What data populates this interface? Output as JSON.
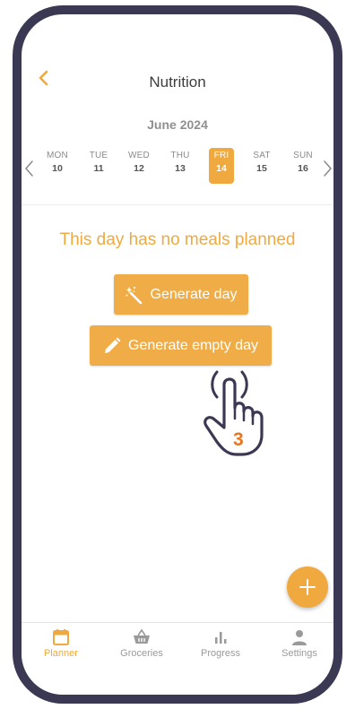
{
  "header": {
    "title": "Nutrition",
    "back_icon": "chevron-left-icon"
  },
  "calendar": {
    "month": "June 2024",
    "days": [
      {
        "name": "MON",
        "date": "10",
        "selected": false
      },
      {
        "name": "TUE",
        "date": "11",
        "selected": false
      },
      {
        "name": "WED",
        "date": "12",
        "selected": false
      },
      {
        "name": "THU",
        "date": "13",
        "selected": false
      },
      {
        "name": "FRI",
        "date": "14",
        "selected": true
      },
      {
        "name": "SAT",
        "date": "15",
        "selected": false
      },
      {
        "name": "SUN",
        "date": "16",
        "selected": false
      }
    ]
  },
  "main": {
    "empty_message": "This day has no meals planned",
    "generate_day_label": "Generate day",
    "generate_empty_day_label": "Generate empty day",
    "tap_step": "3"
  },
  "fab": {
    "icon": "plus-icon"
  },
  "tabs": [
    {
      "label": "Planner",
      "icon": "calendar-icon",
      "active": true
    },
    {
      "label": "Groceries",
      "icon": "basket-icon",
      "active": false
    },
    {
      "label": "Progress",
      "icon": "bar-chart-icon",
      "active": false
    },
    {
      "label": "Settings",
      "icon": "user-icon",
      "active": false
    }
  ],
  "colors": {
    "accent": "#f0a93f",
    "frame": "#3b3853"
  }
}
